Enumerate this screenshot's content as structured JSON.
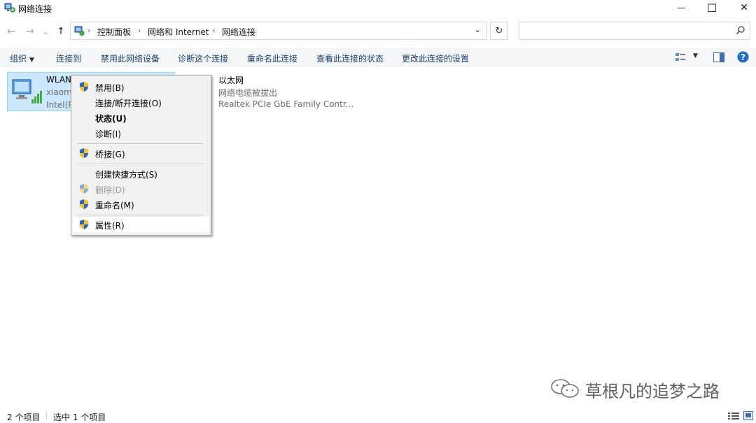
{
  "window": {
    "title": "网络连接",
    "minimize_glyph": "—",
    "maximize_glyph": "☐",
    "close_glyph": "✕"
  },
  "nav": {
    "back_glyph": "←",
    "forward_glyph": "→",
    "recent_glyph": "⌄",
    "up_glyph": "↑"
  },
  "address": {
    "crumbs": [
      "控制面板",
      "网络和 Internet",
      "网络连接"
    ],
    "separator": "›",
    "dropdown_glyph": "⌄",
    "refresh_glyph": "↻"
  },
  "search": {
    "placeholder": "",
    "icon": "search-icon"
  },
  "commands": {
    "organize": "组织",
    "organize_caret": "▼",
    "connect_to": "连接到",
    "disable_device": "禁用此网络设备",
    "diagnose": "诊断这个连接",
    "rename": "重命名此连接",
    "view_status": "查看此连接的状态",
    "change_settings": "更改此连接的设置",
    "view_caret": "▼"
  },
  "items": [
    {
      "name": "WLAN",
      "status": "xiaomi",
      "device": "Intel(R"
    },
    {
      "name": "以太网",
      "status": "网络电缆被拔出",
      "device": "Realtek PCIe GbE Family Contr..."
    }
  ],
  "context_menu": {
    "disable": "禁用(B)",
    "connect_disconnect": "连接/断开连接(O)",
    "status": "状态(U)",
    "diagnose": "诊断(I)",
    "bridge": "桥接(G)",
    "create_shortcut": "创建快捷方式(S)",
    "delete": "删除(D)",
    "rename": "重命名(M)",
    "properties": "属性(R)"
  },
  "status_bar": {
    "count": "2 个项目",
    "selected": "选中 1 个项目"
  },
  "watermark": {
    "text": "草根凡的追梦之路"
  },
  "colors": {
    "selection_bg": "#cce8ff",
    "selection_border": "#99d1ff",
    "command_text": "#1a3e6f",
    "help_blue": "#1f6fd1",
    "shield_blue": "#2b63c6",
    "shield_yellow": "#f3c21b"
  }
}
